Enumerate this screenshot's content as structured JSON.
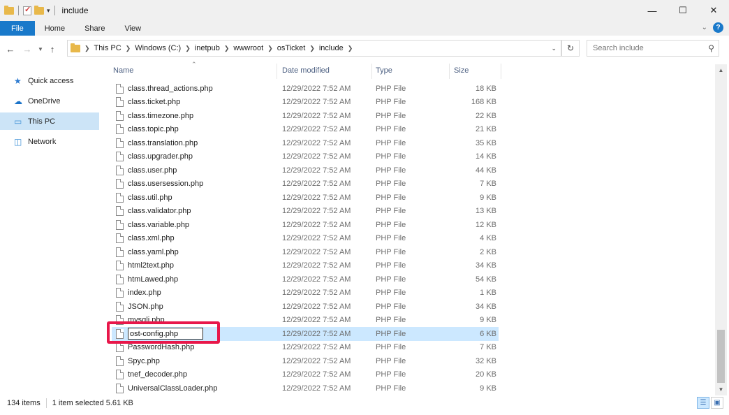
{
  "window": {
    "title": "include"
  },
  "controls": {
    "minimize": "—",
    "maximize": "☐",
    "close": "✕"
  },
  "ribbon": {
    "tabs": [
      "File",
      "Home",
      "Share",
      "View"
    ],
    "help": "?"
  },
  "address": {
    "crumbs": [
      "This PC",
      "Windows (C:)",
      "inetpub",
      "wwwroot",
      "osTicket",
      "include"
    ],
    "search_placeholder": "Search include"
  },
  "nav": {
    "items": [
      {
        "label": "Quick access",
        "icon": "star-icon"
      },
      {
        "label": "OneDrive",
        "icon": "cloud-icon"
      },
      {
        "label": "This PC",
        "icon": "computer-icon"
      },
      {
        "label": "Network",
        "icon": "network-icon"
      }
    ],
    "selected": "This PC"
  },
  "columns": {
    "name": "Name",
    "date": "Date modified",
    "type": "Type",
    "size": "Size"
  },
  "files": [
    {
      "name": "class.thread_actions.php",
      "date": "12/29/2022 7:52 AM",
      "type": "PHP File",
      "size": "18 KB"
    },
    {
      "name": "class.ticket.php",
      "date": "12/29/2022 7:52 AM",
      "type": "PHP File",
      "size": "168 KB"
    },
    {
      "name": "class.timezone.php",
      "date": "12/29/2022 7:52 AM",
      "type": "PHP File",
      "size": "22 KB"
    },
    {
      "name": "class.topic.php",
      "date": "12/29/2022 7:52 AM",
      "type": "PHP File",
      "size": "21 KB"
    },
    {
      "name": "class.translation.php",
      "date": "12/29/2022 7:52 AM",
      "type": "PHP File",
      "size": "35 KB"
    },
    {
      "name": "class.upgrader.php",
      "date": "12/29/2022 7:52 AM",
      "type": "PHP File",
      "size": "14 KB"
    },
    {
      "name": "class.user.php",
      "date": "12/29/2022 7:52 AM",
      "type": "PHP File",
      "size": "44 KB"
    },
    {
      "name": "class.usersession.php",
      "date": "12/29/2022 7:52 AM",
      "type": "PHP File",
      "size": "7 KB"
    },
    {
      "name": "class.util.php",
      "date": "12/29/2022 7:52 AM",
      "type": "PHP File",
      "size": "9 KB"
    },
    {
      "name": "class.validator.php",
      "date": "12/29/2022 7:52 AM",
      "type": "PHP File",
      "size": "13 KB"
    },
    {
      "name": "class.variable.php",
      "date": "12/29/2022 7:52 AM",
      "type": "PHP File",
      "size": "12 KB"
    },
    {
      "name": "class.xml.php",
      "date": "12/29/2022 7:52 AM",
      "type": "PHP File",
      "size": "4 KB"
    },
    {
      "name": "class.yaml.php",
      "date": "12/29/2022 7:52 AM",
      "type": "PHP File",
      "size": "2 KB"
    },
    {
      "name": "html2text.php",
      "date": "12/29/2022 7:52 AM",
      "type": "PHP File",
      "size": "34 KB"
    },
    {
      "name": "htmLawed.php",
      "date": "12/29/2022 7:52 AM",
      "type": "PHP File",
      "size": "54 KB"
    },
    {
      "name": "index.php",
      "date": "12/29/2022 7:52 AM",
      "type": "PHP File",
      "size": "1 KB"
    },
    {
      "name": "JSON.php",
      "date": "12/29/2022 7:52 AM",
      "type": "PHP File",
      "size": "34 KB"
    },
    {
      "name": "mysqli.php",
      "date": "12/29/2022 7:52 AM",
      "type": "PHP File",
      "size": "9 KB"
    },
    {
      "name": "ost-config.php",
      "date": "12/29/2022 7:52 AM",
      "type": "PHP File",
      "size": "6 KB",
      "selected": true,
      "renaming": true
    },
    {
      "name": "PasswordHash.php",
      "date": "12/29/2022 7:52 AM",
      "type": "PHP File",
      "size": "7 KB"
    },
    {
      "name": "Spyc.php",
      "date": "12/29/2022 7:52 AM",
      "type": "PHP File",
      "size": "32 KB"
    },
    {
      "name": "tnef_decoder.php",
      "date": "12/29/2022 7:52 AM",
      "type": "PHP File",
      "size": "20 KB"
    },
    {
      "name": "UniversalClassLoader.php",
      "date": "12/29/2022 7:52 AM",
      "type": "PHP File",
      "size": "9 KB"
    }
  ],
  "status": {
    "items": "134 items",
    "selection": "1 item selected  5.61 KB"
  },
  "colors": {
    "accent": "#1979ca",
    "selection": "#cce8ff",
    "highlight": "#e8174a",
    "folder": "#e8b84a"
  }
}
